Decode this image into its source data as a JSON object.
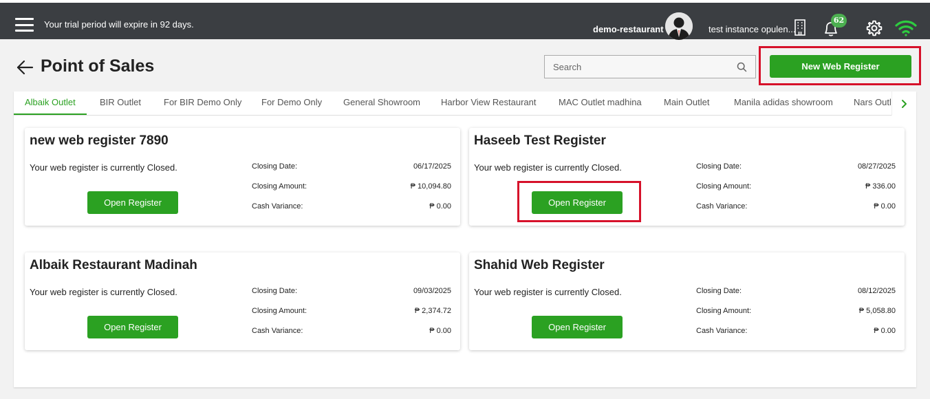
{
  "topbar": {
    "trial_message": "Your trial period will expire in 92 days.",
    "tenant_name": "demo-restaurant",
    "instance_name": "test instance opulen...",
    "notification_count": "62",
    "icons": [
      "menu-icon",
      "avatar",
      "building-icon",
      "bell-icon",
      "gear-icon",
      "wifi-icon"
    ]
  },
  "header": {
    "title": "Point of Sales",
    "search_placeholder": "Search",
    "new_register_label": "New Web Register"
  },
  "tabs": [
    {
      "label": "Albaik Outlet",
      "active": true
    },
    {
      "label": "BIR Outlet"
    },
    {
      "label": "For BIR Demo Only"
    },
    {
      "label": "For Demo Only"
    },
    {
      "label": "General Showroom"
    },
    {
      "label": "Harbor View Restaurant"
    },
    {
      "label": "MAC Outlet madhina"
    },
    {
      "label": "Main Outlet"
    },
    {
      "label": "Manila adidas showroom"
    },
    {
      "label": "Nars Outlet"
    }
  ],
  "registers": [
    {
      "name": "new web register 7890",
      "status": "Your web register is currently Closed.",
      "button_label": "Open Register",
      "closing_date_label": "Closing Date:",
      "closing_date": "06/17/2025",
      "closing_amount_label": "Closing Amount:",
      "closing_amount": "₱ 10,094.80",
      "cash_variance_label": "Cash Variance:",
      "cash_variance": "₱ 0.00"
    },
    {
      "name": "Haseeb Test Register",
      "status": "Your web register is currently Closed.",
      "button_label": "Open Register",
      "closing_date_label": "Closing Date:",
      "closing_date": "08/27/2025",
      "closing_amount_label": "Closing Amount:",
      "closing_amount": "₱ 336.00",
      "cash_variance_label": "Cash Variance:",
      "cash_variance": "₱ 0.00"
    },
    {
      "name": "Albaik Restaurant Madinah",
      "status": "Your web register is currently Closed.",
      "button_label": "Open Register",
      "closing_date_label": "Closing Date:",
      "closing_date": "09/03/2025",
      "closing_amount_label": "Closing Amount:",
      "closing_amount": "₱ 2,374.72",
      "cash_variance_label": "Cash Variance:",
      "cash_variance": "₱ 0.00"
    },
    {
      "name": "Shahid Web Register",
      "status": "Your web register is currently Closed.",
      "button_label": "Open Register",
      "closing_date_label": "Closing Date:",
      "closing_date": "08/12/2025",
      "closing_amount_label": "Closing Amount:",
      "closing_amount": "₱ 5,058.80",
      "cash_variance_label": "Cash Variance:",
      "cash_variance": "₱ 0.00"
    }
  ],
  "colors": {
    "topbar": "#3b3e42",
    "accent_green": "#2ba122",
    "badge_green": "#4caf50",
    "highlight_red": "#d6112a"
  }
}
